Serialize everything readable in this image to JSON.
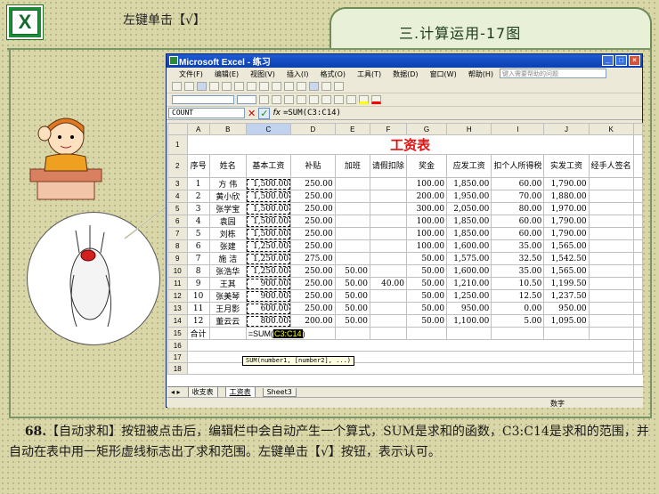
{
  "header": {
    "left_text": "左键单击【√】",
    "right_text": "三.计算运用-17图"
  },
  "excel": {
    "window_title": "Microsoft Excel - 练习",
    "menu": [
      "文件(F)",
      "编辑(E)",
      "视图(V)",
      "插入(I)",
      "格式(O)",
      "工具(T)",
      "数据(D)",
      "窗口(W)",
      "帮助(H)"
    ],
    "help_placeholder": "键入需要帮助的问题",
    "name_box": "COUNT",
    "formula": "=SUM(C3:C14)",
    "columns": [
      "A",
      "B",
      "C",
      "D",
      "E",
      "F",
      "G",
      "H",
      "I",
      "J",
      "K"
    ],
    "sheet_title": "工资表",
    "headers": [
      "序号",
      "姓名",
      "基本工资",
      "补贴",
      "加班",
      "请假扣除",
      "奖金",
      "应发工资",
      "扣个人所得税",
      "实发工资",
      "经手人签名"
    ],
    "rows": [
      {
        "n": "1",
        "name": "方 伟",
        "base": "1,500.00",
        "sub": "250.00",
        "ot": "",
        "leave": "",
        "bonus": "100.00",
        "gross": "1,850.00",
        "tax": "60.00",
        "net": "1,790.00"
      },
      {
        "n": "2",
        "name": "黄小欣",
        "base": "1,500.00",
        "sub": "250.00",
        "ot": "",
        "leave": "",
        "bonus": "200.00",
        "gross": "1,950.00",
        "tax": "70.00",
        "net": "1,880.00"
      },
      {
        "n": "3",
        "name": "张学宝",
        "base": "1,500.00",
        "sub": "250.00",
        "ot": "",
        "leave": "",
        "bonus": "300.00",
        "gross": "2,050.00",
        "tax": "80.00",
        "net": "1,970.00"
      },
      {
        "n": "4",
        "name": "袁园",
        "base": "1,500.00",
        "sub": "250.00",
        "ot": "",
        "leave": "",
        "bonus": "100.00",
        "gross": "1,850.00",
        "tax": "60.00",
        "net": "1,790.00"
      },
      {
        "n": "5",
        "name": "刘栋",
        "base": "1,500.00",
        "sub": "250.00",
        "ot": "",
        "leave": "",
        "bonus": "100.00",
        "gross": "1,850.00",
        "tax": "60.00",
        "net": "1,790.00"
      },
      {
        "n": "6",
        "name": "张建",
        "base": "1,250.00",
        "sub": "250.00",
        "ot": "",
        "leave": "",
        "bonus": "100.00",
        "gross": "1,600.00",
        "tax": "35.00",
        "net": "1,565.00"
      },
      {
        "n": "7",
        "name": "施 洁",
        "base": "1,250.00",
        "sub": "275.00",
        "ot": "",
        "leave": "",
        "bonus": "50.00",
        "gross": "1,575.00",
        "tax": "32.50",
        "net": "1,542.50"
      },
      {
        "n": "8",
        "name": "张浩华",
        "base": "1,250.00",
        "sub": "250.00",
        "ot": "50.00",
        "leave": "",
        "bonus": "50.00",
        "gross": "1,600.00",
        "tax": "35.00",
        "net": "1,565.00"
      },
      {
        "n": "9",
        "name": "王其",
        "base": "900.00",
        "sub": "250.00",
        "ot": "50.00",
        "leave": "40.00",
        "bonus": "50.00",
        "gross": "1,210.00",
        "tax": "10.50",
        "net": "1,199.50"
      },
      {
        "n": "10",
        "name": "张美琴",
        "base": "900.00",
        "sub": "250.00",
        "ot": "50.00",
        "leave": "",
        "bonus": "50.00",
        "gross": "1,250.00",
        "tax": "12.50",
        "net": "1,237.50"
      },
      {
        "n": "11",
        "name": "王月影",
        "base": "600.00",
        "sub": "250.00",
        "ot": "50.00",
        "leave": "",
        "bonus": "50.00",
        "gross": "950.00",
        "tax": "0.00",
        "net": "950.00"
      },
      {
        "n": "12",
        "name": "董云云",
        "base": "800.00",
        "sub": "200.00",
        "ot": "50.00",
        "leave": "",
        "bonus": "50.00",
        "gross": "1,100.00",
        "tax": "5.00",
        "net": "1,095.00"
      }
    ],
    "row15_label": "合计",
    "sum_prefix": "=SUM(",
    "sum_range": "C3:C14",
    "tooltip": "SUM(number1, [number2], ...)",
    "sheet_tabs": [
      "收支表",
      "工资表",
      "Sheet3"
    ],
    "status_mode": "数字"
  },
  "caption": {
    "number": "68.",
    "text": "【自动求和】按钮被点击后，编辑栏中会自动产生一个算式，SUM是求和的函数，C3:C14是求和的范围，并自动在表中用一矩形虚线标志出了求和范围。左键单击【√】按钮，表示认可。"
  }
}
